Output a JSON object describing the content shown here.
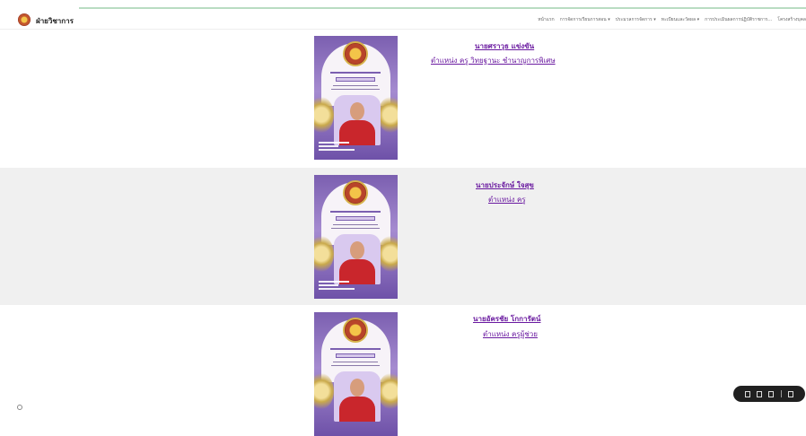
{
  "header": {
    "site_name": "ฝ่ายวิชาการ",
    "nav": [
      "หน้าแรก",
      "การจัดการเรียนการสอน ▾",
      "ประมวลการจัดการ ▾",
      "ทะเบียนและวัดผล ▾",
      "การประเมินผลการปฏิบัติราชการ...",
      "โครงสร้างบุคล"
    ]
  },
  "personnel": [
    {
      "name": "นายศราวุธ    แข่งขัน",
      "position": "ตำแหน่ง ครู วิทยฐานะ ชำนาญการพิเศษ"
    },
    {
      "name": "นายประจักษ์   ใจสุข",
      "position": "ตำแหน่ง ครู"
    },
    {
      "name": "นายอัครชัย   โกการัตน์",
      "position": "ตำแหน่ง ครูผู้ช่วย"
    }
  ],
  "colors": {
    "link": "#6a1aa0",
    "poster_purple": "#7b5fb0",
    "alt_row_bg": "#f0f0f0"
  }
}
